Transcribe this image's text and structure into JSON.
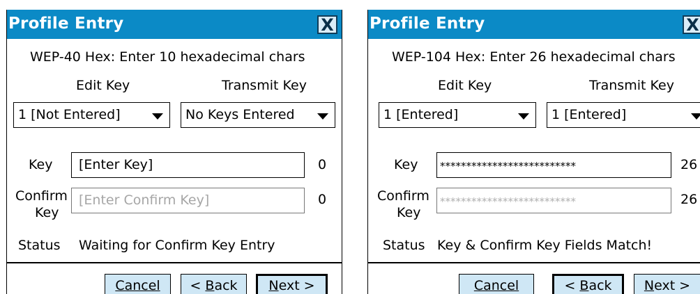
{
  "panels": [
    {
      "title": "Profile Entry",
      "close": "X",
      "header": "WEP-40 Hex: Enter 10 hexadecimal chars",
      "edit_key_label": "Edit Key",
      "transmit_key_label": "Transmit Key",
      "edit_key_value": "1 [Not Entered]",
      "transmit_key_value": "No Keys Entered",
      "key_label": "Key",
      "key_value": "[Enter Key]",
      "key_count": "0",
      "confirm_label_1": "Confirm",
      "confirm_label_2": "Key",
      "confirm_value": "[Enter Confirm Key]",
      "confirm_count": "0",
      "status_label": "Status",
      "status_value": "Waiting for Confirm Key Entry",
      "cancel": "Cancel",
      "back_prefix": "< ",
      "back_u": "B",
      "back_rest": "ack",
      "next_u": "N",
      "next_rest": "ext >"
    },
    {
      "title": "Profile Entry",
      "close": "X",
      "header": "WEP-104 Hex: Enter 26 hexadecimal chars",
      "edit_key_label": "Edit Key",
      "transmit_key_label": "Transmit Key",
      "edit_key_value": "1 [Entered]",
      "transmit_key_value": "1 [Entered]",
      "key_label": "Key",
      "key_value": "**************************",
      "key_count": "26",
      "confirm_label_1": "Confirm",
      "confirm_label_2": "Key",
      "confirm_value": "**************************",
      "confirm_count": "26",
      "status_label": "Status",
      "status_value": "Key & Confirm Key Fields Match!",
      "cancel": "Cancel",
      "back_prefix": "< ",
      "back_u": "B",
      "back_rest": "ack",
      "next_u": "N",
      "next_rest": "ext >"
    }
  ]
}
